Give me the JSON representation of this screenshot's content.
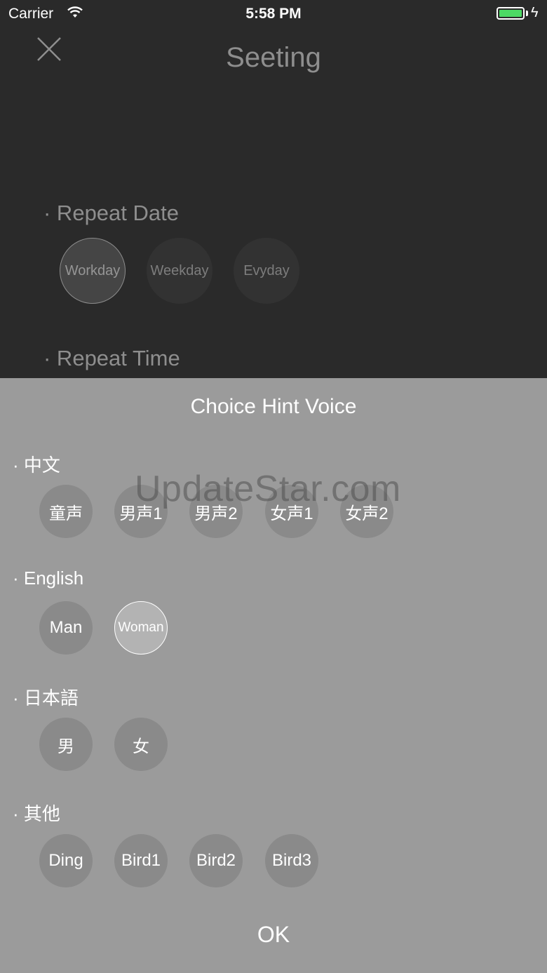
{
  "status_bar": {
    "carrier": "Carrier",
    "time": "5:58 PM",
    "battery_color": "#4cd964"
  },
  "header": {
    "title": "Seeting",
    "close_icon": "close-icon"
  },
  "background": {
    "repeat_date_label": "· Repeat Date",
    "date_options": [
      {
        "label": "Workday",
        "selected": true
      },
      {
        "label": "Weekday",
        "selected": false
      },
      {
        "label": "Evyday",
        "selected": false
      }
    ],
    "repeat_time_label": "· Repeat Time"
  },
  "sheet": {
    "title": "Choice Hint Voice",
    "groups": [
      {
        "label": "· 中文",
        "options": [
          "童声",
          "男声1",
          "男声2",
          "女声1",
          "女声2"
        ]
      },
      {
        "label": "· English",
        "options": [
          "Man",
          "Woman"
        ],
        "selected": "Woman"
      },
      {
        "label": "· 日本語",
        "options": [
          "男",
          "女"
        ]
      },
      {
        "label": "· 其他",
        "options": [
          "Ding",
          "Bird1",
          "Bird2",
          "Bird3"
        ]
      }
    ],
    "ok_label": "OK"
  },
  "watermark": "UpdateStar.com"
}
